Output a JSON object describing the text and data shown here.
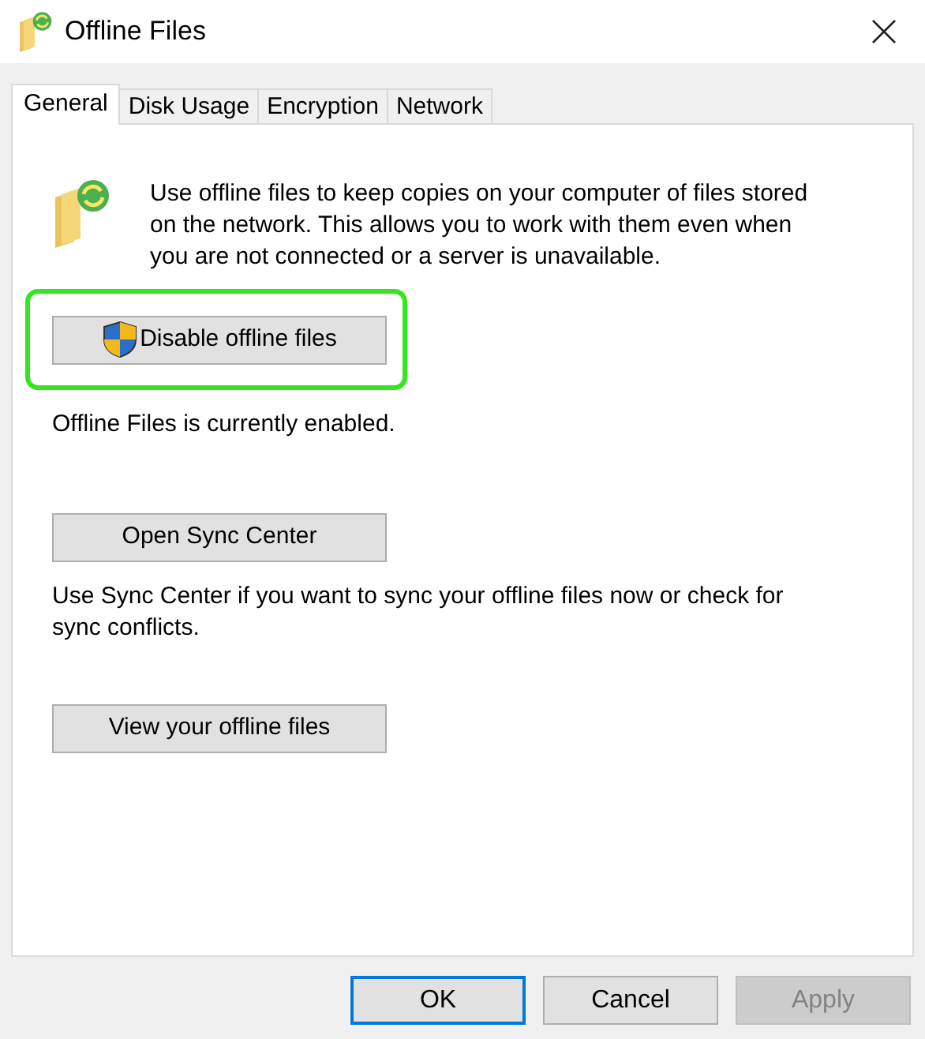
{
  "window": {
    "title": "Offline Files"
  },
  "tabs": [
    {
      "label": "General",
      "selected": true
    },
    {
      "label": "Disk Usage",
      "selected": false
    },
    {
      "label": "Encryption",
      "selected": false
    },
    {
      "label": "Network",
      "selected": false
    }
  ],
  "intro": "Use offline files to keep copies on your computer of files stored on the network.  This allows you to work with them even when you are not connected or a server is unavailable.",
  "content": [
    {
      "kind": "button",
      "label": "Disable offline files",
      "shield": true,
      "highlighted": true
    },
    {
      "kind": "text",
      "text": "Offline Files is currently enabled."
    },
    {
      "kind": "button",
      "label": "Open Sync Center",
      "shield": false,
      "highlighted": false
    },
    {
      "kind": "text",
      "text": "Use Sync Center if you want to sync your offline files now or check for sync conflicts."
    },
    {
      "kind": "button",
      "label": "View your offline files",
      "shield": false,
      "highlighted": false
    }
  ],
  "buttons": [
    {
      "label": "OK",
      "default": true,
      "disabled": false
    },
    {
      "label": "Cancel",
      "default": false,
      "disabled": false
    },
    {
      "label": "Apply",
      "default": false,
      "disabled": true
    }
  ]
}
